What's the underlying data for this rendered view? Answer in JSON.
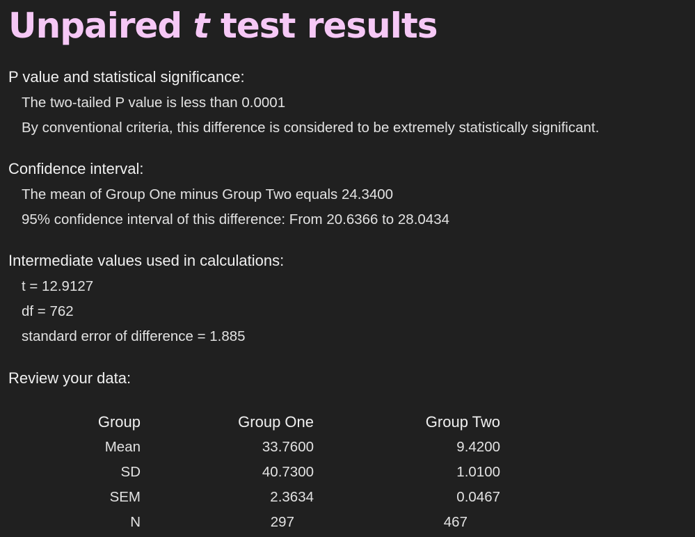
{
  "title": {
    "before": "Unpaired ",
    "variable": "t",
    "after": " test results"
  },
  "pvalue": {
    "heading": "P value and statistical significance:",
    "line1": "The two-tailed P value is less than 0.0001",
    "line2": "By conventional criteria, this difference is considered to be extremely statistically significant."
  },
  "confidence": {
    "heading": "Confidence interval:",
    "line1": "The mean of Group One minus Group Two equals 24.3400",
    "line2": "95% confidence interval of this difference: From 20.6366 to 28.0434"
  },
  "intermediate": {
    "heading": "Intermediate values used in calculations:",
    "t": "t = 12.9127",
    "df": "df = 762",
    "se": "standard error of difference = 1.885"
  },
  "review": {
    "heading": "Review your data:",
    "headers": [
      "Group",
      "Group One",
      "Group Two"
    ],
    "rows": [
      [
        "Mean",
        "33.7600",
        "9.4200"
      ],
      [
        "SD",
        "40.7300",
        "1.0100"
      ],
      [
        "SEM",
        "2.3634",
        "0.0467"
      ],
      [
        "N",
        "297",
        "467"
      ]
    ]
  }
}
